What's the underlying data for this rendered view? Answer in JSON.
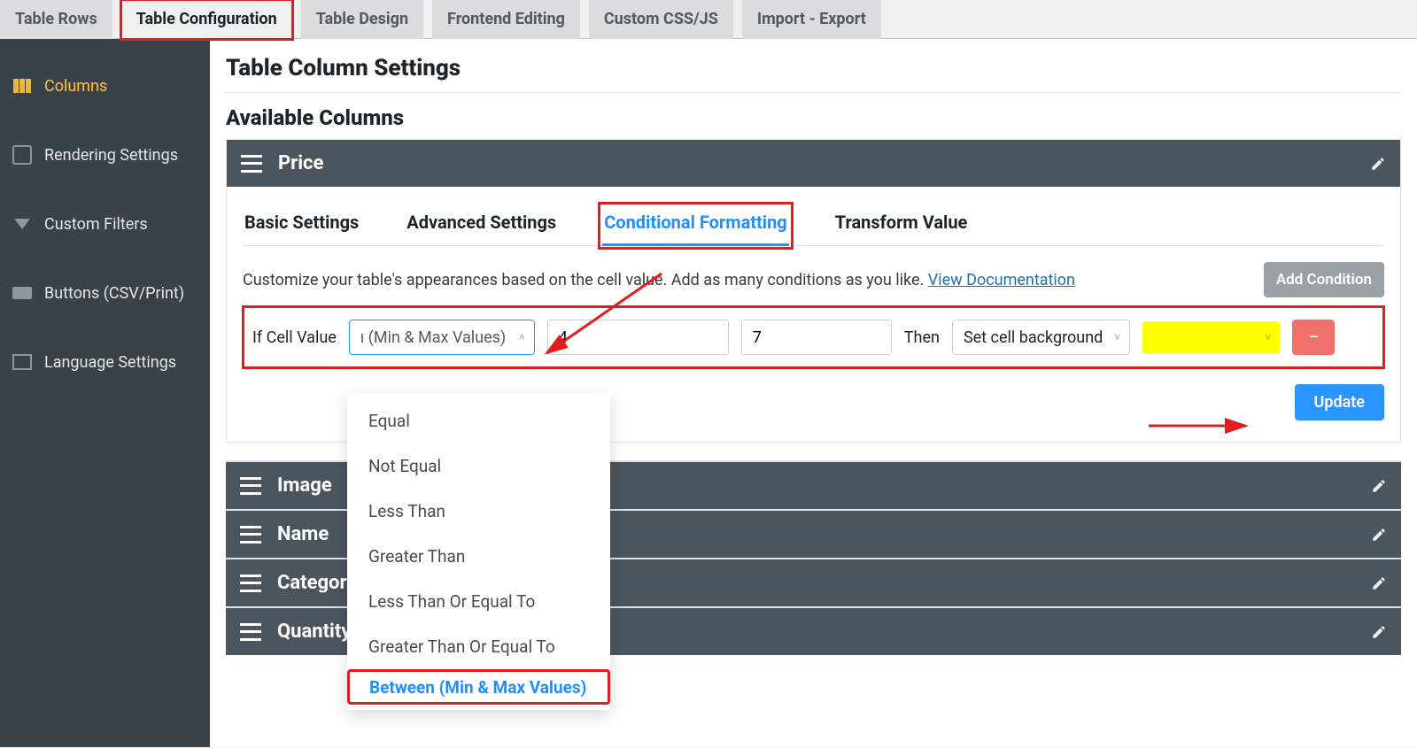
{
  "tabs": {
    "rows": "Table Rows",
    "config": "Table Configuration",
    "design": "Table Design",
    "frontend": "Frontend Editing",
    "css": "Custom CSS/JS",
    "import": "Import - Export"
  },
  "sidebar": {
    "columns": "Columns",
    "rendering": "Rendering Settings",
    "filters": "Custom Filters",
    "buttons": "Buttons (CSV/Print)",
    "language": "Language Settings"
  },
  "page": {
    "title": "Table Column Settings",
    "section": "Available Columns"
  },
  "column_panel": {
    "title": "Price",
    "inner_tabs": {
      "basic": "Basic Settings",
      "advanced": "Advanced Settings",
      "conditional": "Conditional Formatting",
      "transform": "Transform Value"
    },
    "desc_pre": "Customize your table's appearances based on the cell value. Add as many conditions as you like. ",
    "doc_link": "View Documentation",
    "add_condition": "Add Condition",
    "update": "Update"
  },
  "condition": {
    "if_label": "If Cell Value",
    "operator_display": "ı (Min & Max Values)",
    "min": "4",
    "max": "7",
    "then_label": "Then",
    "action_display": "Set cell background",
    "color": "#ffff00"
  },
  "operator_options": [
    "Equal",
    "Not Equal",
    "Less Than",
    "Greater Than",
    "Less Than Or Equal To",
    "Greater Than Or Equal To",
    "Between (Min & Max Values)"
  ],
  "collapsed_columns": [
    "Image",
    "Name",
    "Category",
    "Quantity"
  ]
}
